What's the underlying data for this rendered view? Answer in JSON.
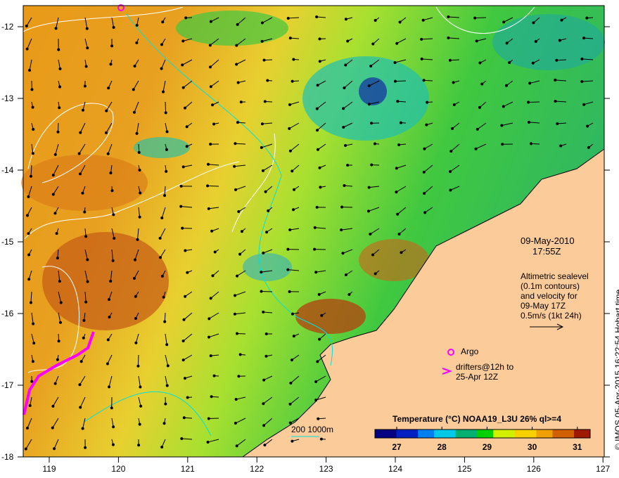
{
  "map": {
    "date": "09-May-2010",
    "time": "17:55Z",
    "altimetry_note": [
      "Altimetric sealevel",
      "(0.1m contours)",
      "and velocity for",
      "09-May 17Z",
      "0.5m/s (1kt 24h)"
    ],
    "legend_argo": "Argo",
    "legend_drifters": [
      "drifters@12h to",
      "25-Apr 12Z"
    ],
    "depth_contours_label": "200  1000m",
    "colorbar_title": "Temperature (°C) NOAA19_L3U 26% ql>=4",
    "colorbar_ticks": [
      "27",
      "28",
      "29",
      "30",
      "31"
    ],
    "credit": "© IMOS 05-Apr-2015 16:22:54 Hobart time",
    "lat_ticks": [
      "-12",
      "-13",
      "-14",
      "-15",
      "-16",
      "-17",
      "-18"
    ],
    "lon_ticks": [
      "119",
      "120",
      "121",
      "122",
      "123",
      "124",
      "125",
      "126",
      "127"
    ],
    "colors": {
      "land": "#fccb9a",
      "argo": "#ff00ff",
      "drifter": "#ff00ff",
      "contour_200": "#00e0e0"
    }
  }
}
